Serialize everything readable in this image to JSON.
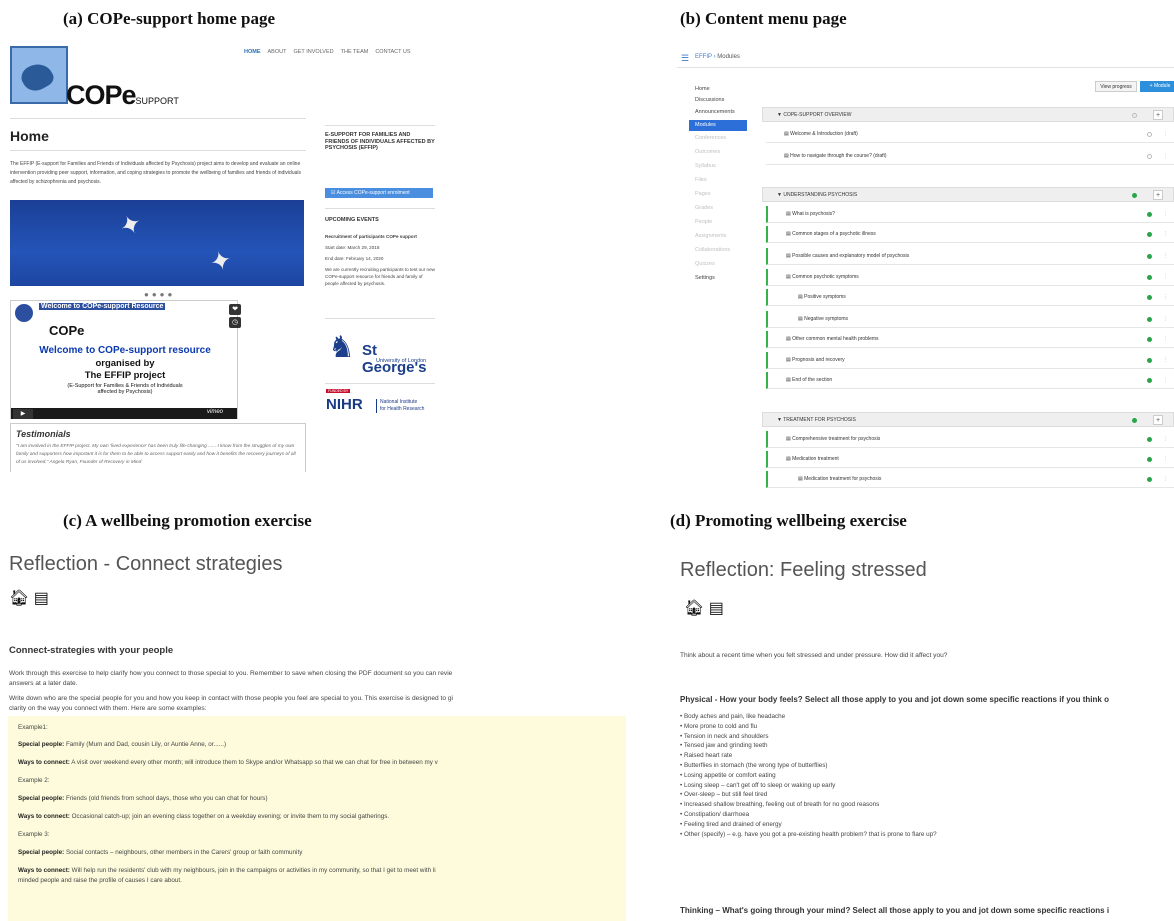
{
  "captions": {
    "a": "(a)  COPe-support home page",
    "b": "(b) Content menu page",
    "c": "(c) A wellbeing promotion exercise",
    "d": "(d) Promoting wellbeing exercise"
  },
  "home": {
    "logo_text": "COPe",
    "logo_sub": "SUPPORT",
    "nav": [
      "HOME",
      "ABOUT",
      "GET INVOLVED",
      "THE TEAM",
      "CONTACT US"
    ],
    "title": "Home",
    "intro": "The EFFIP (E-support for Families and Friends of Individuals affected by Psychosis) project aims to develop and evaluate an online intervention providing peer support, information, and coping strategies to promote the wellbeing of families and friends of individuals affected by schizophrenia and psychosis.",
    "video": {
      "title": "Welcome to COPe-support Resource",
      "logo": "COPe",
      "welcome": "Welcome to COPe-support resource",
      "organised": "organised by",
      "project": "The EFFIP project",
      "sub": "(E-Support for Families & Friends of Individuals affected by Psychosis)",
      "controls": "vimeo"
    },
    "testimonials": {
      "title": "Testimonials",
      "quote": "\"I am involved in the EFFIP project. My own 'lived-experience' has been truly life-changing ...... I know from the struggles of my own family and supporters how important it is for them to be able to access support easily and how it benefits the recovery journeys of all of us involved.\" Angela Ryan, Founder of Recovery in Mind"
    },
    "sidebar": {
      "heading": "E-SUPPORT FOR FAMILIES AND FRIENDS OF INDIVIDUALS AFFECTED BY PSYCHOSIS (EFFIP)",
      "button": "Access COPe-support enrolment",
      "events_title": "UPCOMING EVENTS",
      "event_lines": [
        "Recruitment of participants COPe support",
        "Start date: March 29, 2018",
        "End date: February 14, 2020",
        "We are currently recruiting participants to test our new COPe-support resource for friends and family of people affected by psychosis."
      ],
      "stgeorges": "St George's",
      "stgeorges_sub": "University of London",
      "funded": "FUNDED BY",
      "nihr": "NIHR",
      "nihr_sub1": "National Institute",
      "nihr_sub2": "for Health Research"
    }
  },
  "modules": {
    "breadcrumb": [
      "EFFIP",
      "Modules"
    ],
    "nav": [
      "Home",
      "Discussions",
      "Announcements",
      "Modules",
      "Conferences",
      "Outcomes",
      "Syllabus",
      "Files",
      "Pages",
      "Grades",
      "People",
      "Assignments",
      "Collaborations",
      "Quizzes",
      "Settings"
    ],
    "view_progress": "View progress",
    "add_module": "+ Module",
    "sections": [
      {
        "title": "COPE-SUPPORT OVERVIEW",
        "items": [
          "Welcome & Introduction (draft)",
          "How to navigate through the course? (draft)"
        ]
      },
      {
        "title": "UNDERSTANDING PSYCHOSIS",
        "items": [
          "What is psychosis?",
          "Common stages of a psychotic illness",
          "Possible causes and explanatory model of psychosis",
          "Common psychotic symptoms",
          "Positive symptoms",
          "Negative symptoms",
          "Other common mental health problems",
          "Prognosis and recovery",
          "End of the section"
        ]
      },
      {
        "title": "TREATMENT FOR PSYCHOSIS",
        "items": [
          "Comprehensive treatment for psychosis",
          "Medication treatment",
          "Medication treatment for psychosis"
        ]
      }
    ]
  },
  "connect": {
    "title": "Reflection - Connect strategies",
    "subheading": "Connect-strategies with your people",
    "para1": "Work through this exercise to help clarify how you connect to those special to you. Remember to save when closing the PDF document so you can revie",
    "para1b": "answers at a later date.",
    "para2": "Write down who are the special people for you and how you keep in contact with those people you feel are special to you. This exercise is designed to gi",
    "para2b": "clarity on the way you connect with them. Here are some examples:",
    "examples": [
      {
        "label": "Example1:",
        "people_label": "Special people:",
        "people": " Family (Mum and Dad, cousin Lily, or Auntie Anne, or......)",
        "ways_label": "Ways to connect:",
        "ways": " A visit over weekend every other month; will introduce them to Skype and/or Whatsapp so that we can chat for free in between my v"
      },
      {
        "label": "Example 2:",
        "people_label": "Special people:",
        "people": " Friends (old friends from school days, those who you can chat for hours)",
        "ways_label": "Ways to connect:",
        "ways": " Occasional catch-up; join an evening class together on a weekday evening; or invite them to my social gatherings."
      },
      {
        "label": "Example 3:",
        "people_label": "Special people:",
        "people": " Social contacts – neighbours, other members in the Carers' group or faith community",
        "ways_label": "Ways to connect:",
        "ways": " Will help run the residents' club with my neighbours, join in the campaigns or activities in my community, so that I get to meet with li",
        "ways2": "minded people and raise the profile of causes I care about."
      }
    ]
  },
  "stressed": {
    "title": "Reflection: Feeling stressed",
    "intro": "Think about a recent time when you felt stressed and under pressure. How did it affect you?",
    "physical_heading": "Physical - How your body feels? Select all those apply to you and jot down some specific reactions if you think o",
    "items": [
      "Body aches and pain, like headache",
      "More prone to cold and flu",
      "Tension in neck and shoulders",
      "Tensed jaw and grinding teeth",
      "Raised heart rate",
      "Butterflies in stomach (the wrong type of butterflies)",
      "Losing appetite or comfort eating",
      "Losing sleep – can't get off to sleep or waking up early",
      "Over-sleep – but still feel tired",
      "Increased shallow breathing, feeling out of breath for no good reasons",
      "Constipation/ diarrhoea",
      "Feeling tired and drained of energy",
      "Other (specify) – e.g. have you got a pre-existing health problem? that is prone to flare up?"
    ],
    "thinking_heading": "Thinking – What's going through your mind? Select all those apply to you and jot down some specific reactions i"
  }
}
